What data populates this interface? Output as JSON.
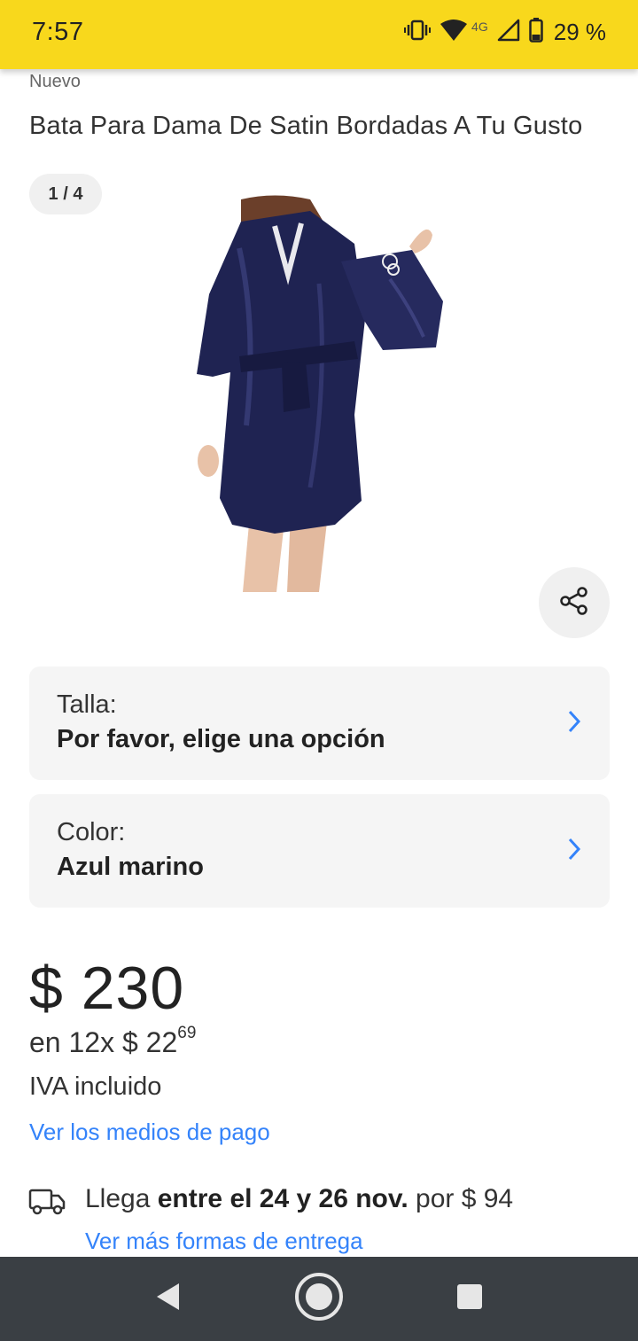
{
  "status_bar": {
    "time": "7:57",
    "network_label": "4G",
    "battery": "29 %",
    "icons": [
      "vibrate-icon",
      "wifi-icon",
      "signal-icon",
      "battery-icon"
    ]
  },
  "product": {
    "condition": "Nuevo",
    "title": "Bata Para Dama De Satin Bordadas A Tu Gusto",
    "image_counter": "1 / 4",
    "image": "navy-satin-robe-photo"
  },
  "variations": [
    {
      "label": "Talla:",
      "value": "Por favor, elige una opción"
    },
    {
      "label": "Color:",
      "value": "Azul marino"
    }
  ],
  "pricing": {
    "price": "$ 230",
    "installments_prefix": "en 12x $ 22",
    "installments_cents": "69",
    "tax_note": "IVA incluido",
    "payment_link": "Ver los medios de pago"
  },
  "shipping": {
    "prefix": "Llega ",
    "dates": "entre el 24 y 26 nov.",
    "suffix": " por $ 94",
    "more_link": "Ver más formas de entrega"
  },
  "colors": {
    "status_bar": "#f8d81c",
    "link": "#3483fa",
    "robe": "#1f2352",
    "nav_bar": "#3a3f44"
  }
}
